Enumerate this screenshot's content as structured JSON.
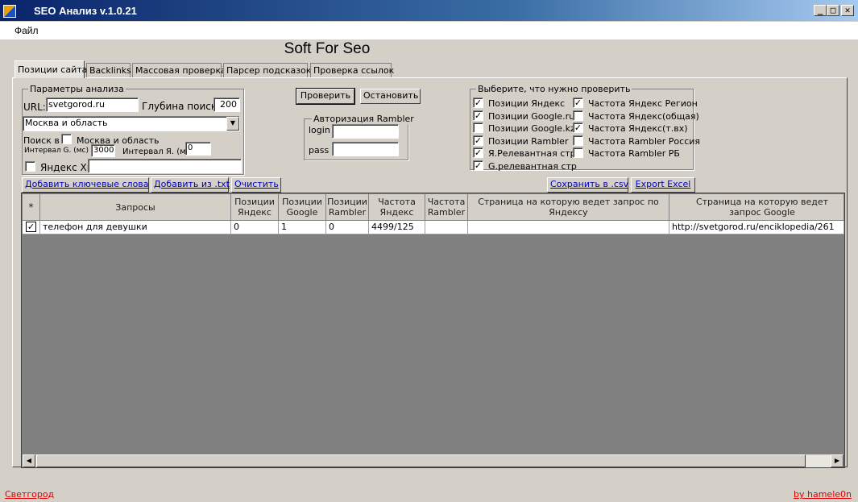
{
  "window": {
    "title": "SEO Анализ v.1.0.21",
    "min_glyph": "_",
    "max_glyph": "□",
    "close_glyph": "✕"
  },
  "menu": {
    "file": "Файл"
  },
  "app_heading": "Soft For Seo",
  "tabs": [
    {
      "label": "Позиции сайта",
      "active": true
    },
    {
      "label": "Backlinks"
    },
    {
      "label": "Массовая проверка"
    },
    {
      "label": "Парсер подсказок"
    },
    {
      "label": "Проверка ссылок"
    }
  ],
  "params": {
    "legend": "Параметры анализа",
    "url_label": "URL:",
    "url_value": "svetgorod.ru",
    "depth_label": "Глубина поиска:",
    "depth_value": "200",
    "region_value": "Москва и область",
    "search_in_label": "Поиск в",
    "search_in_region_label": "Москва и область",
    "interval_g_label": "Интервал G. (мс)",
    "interval_g_value": "3000",
    "interval_y_label": "Интервал Я. (мс",
    "interval_y_value": "0",
    "yandex_xml_label": "Яндекс Xml",
    "yandex_xml_value": ""
  },
  "actions": {
    "check": "Проверить",
    "stop": "Остановить"
  },
  "rambler_auth": {
    "legend": "Авторизация Rambler",
    "login_label": "login",
    "pass_label": "pass",
    "login_value": "",
    "pass_value": ""
  },
  "checks": {
    "legend": "Выберите, что нужно проверить",
    "left": [
      {
        "label": "Позиции Яндекс",
        "checked": true
      },
      {
        "label": "Позиции Google.ru",
        "checked": true
      },
      {
        "label": "Позиции Google.kz",
        "checked": false
      },
      {
        "label": "Позиции Rambler",
        "checked": true
      },
      {
        "label": "Я.Релевантная стр",
        "checked": true
      },
      {
        "label": "G.релевантная стр",
        "checked": true
      }
    ],
    "right": [
      {
        "label": "Частота Яндекс Регион",
        "checked": true
      },
      {
        "label": "Частота Яндекс(общая)",
        "checked": false
      },
      {
        "label": "Частота Яндекс(т.вх)",
        "checked": true
      },
      {
        "label": "Частота Rambler Россия",
        "checked": false
      },
      {
        "label": "Частота Rambler РБ",
        "checked": false
      }
    ],
    "check_mark": "✓"
  },
  "toolbar": {
    "add_keywords": "Добавить ключевые слова",
    "add_from_txt": "Добавить из .txt",
    "clear": "Очистить",
    "save_csv": "Сохранить в .csv",
    "export_excel": "Export Excel"
  },
  "grid": {
    "star": "*",
    "columns": [
      "Запросы",
      "Позиции Яндекс",
      "Позиции Google",
      "Позиции Rambler",
      "Частота Яндекс",
      "Частота Rambler",
      "Страница на которую ведет запрос по Яндексу",
      "Страница на которую ведет запрос Google"
    ],
    "rows": [
      {
        "checked": true,
        "cells": [
          "телефон для девушки",
          "0",
          "1",
          "0",
          "4499/125",
          "",
          "",
          "http://svetgorod.ru/enciklopedia/261"
        ]
      }
    ],
    "scroll_left": "◀",
    "scroll_right": "▶"
  },
  "footer": {
    "left_link": "Светгород",
    "right_link": "by hamele0n"
  }
}
